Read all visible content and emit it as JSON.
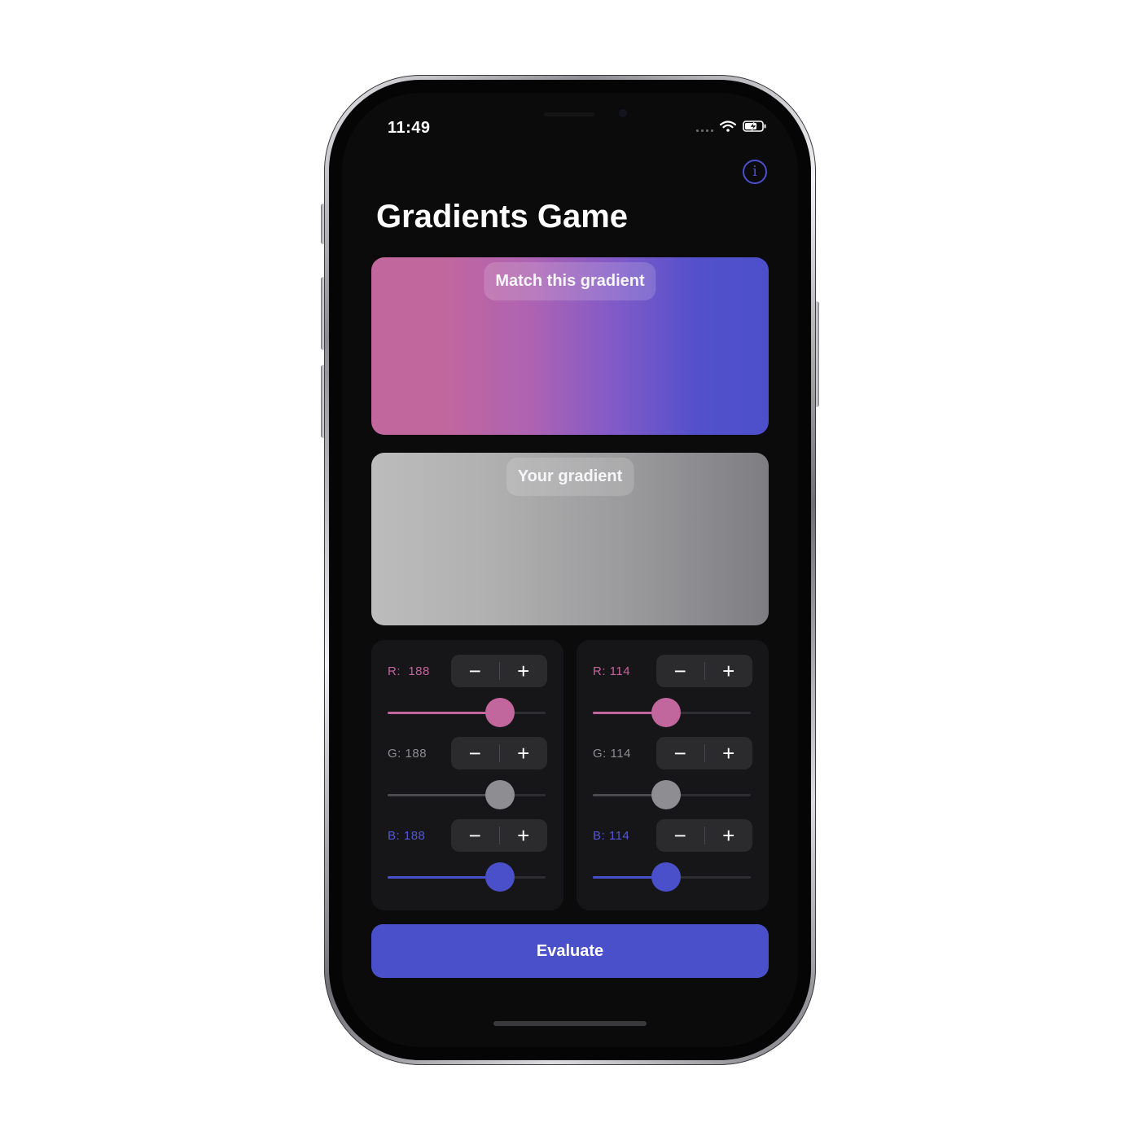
{
  "status_bar": {
    "time": "11:49"
  },
  "header": {
    "title": "Gradients Game",
    "info_icon": "info-circle-icon"
  },
  "target_card": {
    "label": "Match this gradient",
    "start_color": "#c2669e",
    "end_color": "#4c4fcb"
  },
  "user_card": {
    "label": "Your gradient",
    "start_color": "#bcbcbc",
    "end_color": "#7e7e82"
  },
  "controls": {
    "decrement_symbol": "−",
    "increment_symbol": "+",
    "left": {
      "r_label": "R:",
      "r_value": "188",
      "g_label": "G:",
      "g_value": "188",
      "b_label": "B:",
      "b_value": "188"
    },
    "right": {
      "r_label": "R:",
      "r_value": "114",
      "g_label": "G:",
      "g_value": "114",
      "b_label": "B:",
      "b_value": "114"
    }
  },
  "evaluate_label": "Evaluate",
  "colors": {
    "accent": "#4a4fca",
    "red_channel": "#c2669e",
    "green_channel": "#8e8e92",
    "blue_channel": "#4a4fca",
    "background": "#0b0b0c"
  }
}
